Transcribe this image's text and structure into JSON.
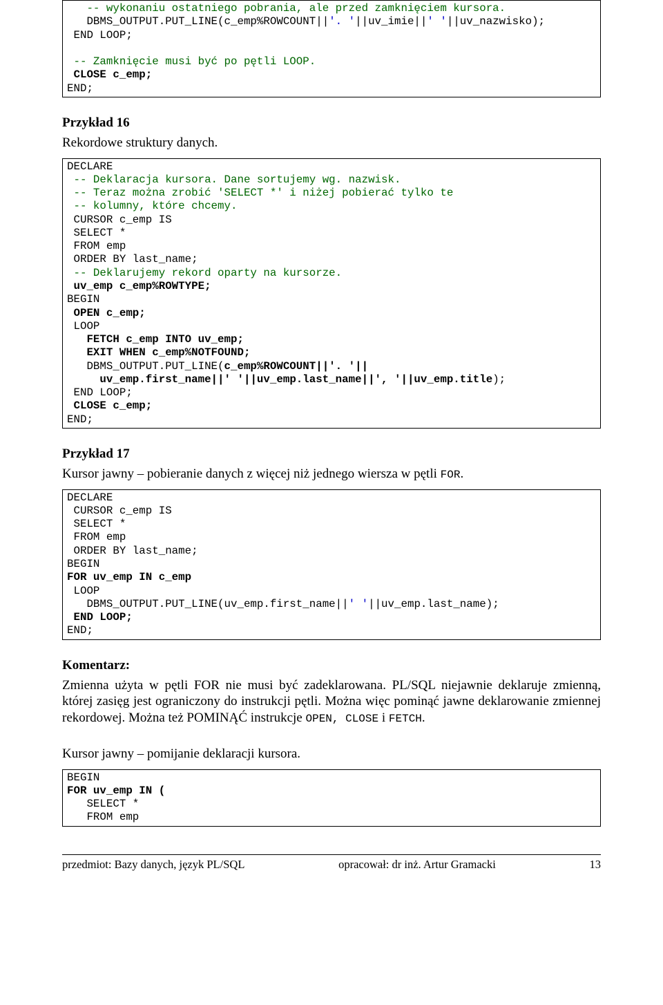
{
  "code1_l1": "   -- wykonaniu ostatniego pobrania, ale przed zamknięciem kursora.",
  "code1_l2a": "   DBMS_OUTPUT.PUT_LINE(c_emp%ROWCOUNT||",
  "code1_l2b": "'. '",
  "code1_l2c": "||uv_imie||",
  "code1_l2d": "' '",
  "code1_l2e": "||uv_nazwisko);",
  "code1_l3": " END LOOP;",
  "code1_l4": "",
  "code1_l5": " -- Zamknięcie musi być po pętli LOOP.",
  "code1_l6": " CLOSE c_emp;",
  "code1_l7": "END;",
  "h16": "Przykład 16",
  "p16": "Rekordowe struktury danych.",
  "c2_l1": "DECLARE",
  "c2_l2": " -- Deklaracja kursora. Dane sortujemy wg. nazwisk.",
  "c2_l3": " -- Teraz można zrobić 'SELECT *' i niżej pobierać tylko te",
  "c2_l4": " -- kolumny, które chcemy.",
  "c2_l5": " CURSOR c_emp IS",
  "c2_l6": " SELECT *",
  "c2_l7": " FROM emp",
  "c2_l8": " ORDER BY last_name;",
  "c2_l9": " -- Deklarujemy rekord oparty na kursorze.",
  "c2_l10": " uv_emp c_emp%ROWTYPE;",
  "c2_l11": "BEGIN",
  "c2_l12": " OPEN c_emp;",
  "c2_l13": " LOOP",
  "c2_l14": "   FETCH c_emp INTO uv_emp;",
  "c2_l15": "   EXIT WHEN c_emp%NOTFOUND;",
  "c2_l16a": "   DBMS_OUTPUT.PUT_LINE(",
  "c2_l16b": "c_emp%ROWCOUNT||'. '||",
  "c2_l17a": "     ",
  "c2_l17b": "uv_emp.first_name||' '||uv_emp.last_name||', '||uv_emp.title",
  "c2_l17c": ");",
  "c2_l18": " END LOOP;",
  "c2_l19": " CLOSE c_emp;",
  "c2_l20": "END;",
  "h17": "Przykład 17",
  "p17a": "Kursor jawny – pobieranie danych z więcej niż jednego wiersza w pętli ",
  "p17b": "FOR",
  "p17c": ".",
  "c3_l1": "DECLARE",
  "c3_l2": " CURSOR c_emp IS",
  "c3_l3": " SELECT *",
  "c3_l4": " FROM emp",
  "c3_l5": " ORDER BY last_name;",
  "c3_l6": "BEGIN",
  "c3_l7": "FOR uv_emp IN c_emp",
  "c3_l8": " LOOP",
  "c3_l9a": "   DBMS_OUTPUT.PUT_LINE(uv_emp.first_name||",
  "c3_l9b": "' '",
  "c3_l9c": "||uv_emp.last_name);",
  "c3_l10": " END LOOP;",
  "c3_l11": "END;",
  "kom_h": "Komentarz:",
  "kom_p1a": "Zmienna użyta w pętli FOR nie musi być zadeklarowana. PL/SQL niejawnie deklaruje zmienną, której zasięg jest ograniczony do instrukcji pętli. Można więc pominąć jawne deklarowanie zmiennej rekordowej. Można też POMINĄĆ instrukcje ",
  "kom_p1b": "OPEN, CLOSE",
  "kom_p1c": " i ",
  "kom_p1d": "FETCH",
  "kom_p1e": ".",
  "skip_h": "Kursor jawny – pomijanie deklaracji kursora.",
  "c4_l1": "BEGIN",
  "c4_l2": "FOR uv_emp IN (",
  "c4_l3": "   SELECT *",
  "c4_l4": "   FROM emp",
  "footer_left": "przedmiot: Bazy danych, język PL/SQL",
  "footer_mid": "opracował: dr inż. Artur Gramacki",
  "footer_right": "13"
}
